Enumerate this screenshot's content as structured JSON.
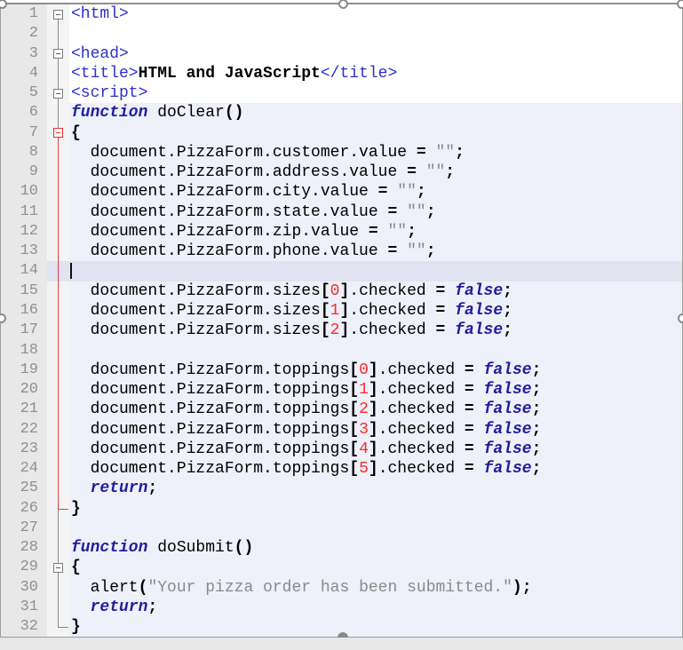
{
  "app": {
    "kind": "code-editor",
    "document_title_in_code": "HTML and JavaScript"
  },
  "colors": {
    "tag_blue": "#2F2FCE",
    "keyword_navy": "#1F1F9C",
    "number_red": "#FA2B2B",
    "string_gray": "#8A8A8A",
    "gutter_bg": "#E8E8E8",
    "js_region_bg": "#EEF0FA",
    "current_line_bg": "#E2E3F0",
    "active_fold_red": "#F23B3B"
  },
  "editor": {
    "current_line": 14,
    "lines": [
      {
        "n": 1,
        "fold": "box-first",
        "region": "html",
        "tokens": [
          [
            "tag",
            "<html>"
          ]
        ]
      },
      {
        "n": 2,
        "fold": "v",
        "region": "html",
        "tokens": []
      },
      {
        "n": 3,
        "fold": "box",
        "region": "html",
        "tokens": [
          [
            "tag",
            "<head>"
          ]
        ]
      },
      {
        "n": 4,
        "fold": "v",
        "region": "html",
        "tokens": [
          [
            "tag",
            "<title>"
          ],
          [
            "b",
            "HTML and JavaScript"
          ],
          [
            "tag",
            "</title>"
          ]
        ]
      },
      {
        "n": 5,
        "fold": "box",
        "region": "html",
        "tokens": [
          [
            "tag",
            "<script>"
          ]
        ]
      },
      {
        "n": 6,
        "fold": "v",
        "region": "js",
        "tokens": [
          [
            "kw",
            "function"
          ],
          [
            "pl",
            " doClear"
          ],
          [
            "op",
            "()"
          ]
        ]
      },
      {
        "n": 7,
        "fold": "box-red",
        "region": "js",
        "tokens": [
          [
            "op",
            "{"
          ]
        ]
      },
      {
        "n": 8,
        "fold": "v-red",
        "region": "js",
        "tokens": [
          [
            "pl",
            "  document.PizzaForm.customer.value "
          ],
          [
            "op",
            "="
          ],
          [
            "pl",
            " "
          ],
          [
            "str",
            "\"\""
          ],
          [
            "op",
            ";"
          ]
        ]
      },
      {
        "n": 9,
        "fold": "v-red",
        "region": "js",
        "tokens": [
          [
            "pl",
            "  document.PizzaForm.address.value "
          ],
          [
            "op",
            "="
          ],
          [
            "pl",
            " "
          ],
          [
            "str",
            "\"\""
          ],
          [
            "op",
            ";"
          ]
        ]
      },
      {
        "n": 10,
        "fold": "v-red",
        "region": "js",
        "tokens": [
          [
            "pl",
            "  document.PizzaForm.city.value "
          ],
          [
            "op",
            "="
          ],
          [
            "pl",
            " "
          ],
          [
            "str",
            "\"\""
          ],
          [
            "op",
            ";"
          ]
        ]
      },
      {
        "n": 11,
        "fold": "v-red",
        "region": "js",
        "tokens": [
          [
            "pl",
            "  document.PizzaForm.state.value "
          ],
          [
            "op",
            "="
          ],
          [
            "pl",
            " "
          ],
          [
            "str",
            "\"\""
          ],
          [
            "op",
            ";"
          ]
        ]
      },
      {
        "n": 12,
        "fold": "v-red",
        "region": "js",
        "tokens": [
          [
            "pl",
            "  document.PizzaForm.zip.value "
          ],
          [
            "op",
            "="
          ],
          [
            "pl",
            " "
          ],
          [
            "str",
            "\"\""
          ],
          [
            "op",
            ";"
          ]
        ]
      },
      {
        "n": 13,
        "fold": "v-red",
        "region": "js",
        "tokens": [
          [
            "pl",
            "  document.PizzaForm.phone.value "
          ],
          [
            "op",
            "="
          ],
          [
            "pl",
            " "
          ],
          [
            "str",
            "\"\""
          ],
          [
            "op",
            ";"
          ]
        ]
      },
      {
        "n": 14,
        "fold": "v-red",
        "region": "js",
        "current": true,
        "caret": true,
        "tokens": []
      },
      {
        "n": 15,
        "fold": "v-red",
        "region": "js",
        "tokens": [
          [
            "pl",
            "  document.PizzaForm.sizes"
          ],
          [
            "op",
            "["
          ],
          [
            "num",
            "0"
          ],
          [
            "op",
            "]"
          ],
          [
            "pl",
            ".checked "
          ],
          [
            "op",
            "="
          ],
          [
            "pl",
            " "
          ],
          [
            "kw",
            "false"
          ],
          [
            "op",
            ";"
          ]
        ]
      },
      {
        "n": 16,
        "fold": "v-red",
        "region": "js",
        "tokens": [
          [
            "pl",
            "  document.PizzaForm.sizes"
          ],
          [
            "op",
            "["
          ],
          [
            "num",
            "1"
          ],
          [
            "op",
            "]"
          ],
          [
            "pl",
            ".checked "
          ],
          [
            "op",
            "="
          ],
          [
            "pl",
            " "
          ],
          [
            "kw",
            "false"
          ],
          [
            "op",
            ";"
          ]
        ]
      },
      {
        "n": 17,
        "fold": "v-red",
        "region": "js",
        "tokens": [
          [
            "pl",
            "  document.PizzaForm.sizes"
          ],
          [
            "op",
            "["
          ],
          [
            "num",
            "2"
          ],
          [
            "op",
            "]"
          ],
          [
            "pl",
            ".checked "
          ],
          [
            "op",
            "="
          ],
          [
            "pl",
            " "
          ],
          [
            "kw",
            "false"
          ],
          [
            "op",
            ";"
          ]
        ]
      },
      {
        "n": 18,
        "fold": "v-red",
        "region": "js",
        "tokens": []
      },
      {
        "n": 19,
        "fold": "v-red",
        "region": "js",
        "tokens": [
          [
            "pl",
            "  document.PizzaForm.toppings"
          ],
          [
            "op",
            "["
          ],
          [
            "num",
            "0"
          ],
          [
            "op",
            "]"
          ],
          [
            "pl",
            ".checked "
          ],
          [
            "op",
            "="
          ],
          [
            "pl",
            " "
          ],
          [
            "kw",
            "false"
          ],
          [
            "op",
            ";"
          ]
        ]
      },
      {
        "n": 20,
        "fold": "v-red",
        "region": "js",
        "tokens": [
          [
            "pl",
            "  document.PizzaForm.toppings"
          ],
          [
            "op",
            "["
          ],
          [
            "num",
            "1"
          ],
          [
            "op",
            "]"
          ],
          [
            "pl",
            ".checked "
          ],
          [
            "op",
            "="
          ],
          [
            "pl",
            " "
          ],
          [
            "kw",
            "false"
          ],
          [
            "op",
            ";"
          ]
        ]
      },
      {
        "n": 21,
        "fold": "v-red",
        "region": "js",
        "tokens": [
          [
            "pl",
            "  document.PizzaForm.toppings"
          ],
          [
            "op",
            "["
          ],
          [
            "num",
            "2"
          ],
          [
            "op",
            "]"
          ],
          [
            "pl",
            ".checked "
          ],
          [
            "op",
            "="
          ],
          [
            "pl",
            " "
          ],
          [
            "kw",
            "false"
          ],
          [
            "op",
            ";"
          ]
        ]
      },
      {
        "n": 22,
        "fold": "v-red",
        "region": "js",
        "tokens": [
          [
            "pl",
            "  document.PizzaForm.toppings"
          ],
          [
            "op",
            "["
          ],
          [
            "num",
            "3"
          ],
          [
            "op",
            "]"
          ],
          [
            "pl",
            ".checked "
          ],
          [
            "op",
            "="
          ],
          [
            "pl",
            " "
          ],
          [
            "kw",
            "false"
          ],
          [
            "op",
            ";"
          ]
        ]
      },
      {
        "n": 23,
        "fold": "v-red",
        "region": "js",
        "tokens": [
          [
            "pl",
            "  document.PizzaForm.toppings"
          ],
          [
            "op",
            "["
          ],
          [
            "num",
            "4"
          ],
          [
            "op",
            "]"
          ],
          [
            "pl",
            ".checked "
          ],
          [
            "op",
            "="
          ],
          [
            "pl",
            " "
          ],
          [
            "kw",
            "false"
          ],
          [
            "op",
            ";"
          ]
        ]
      },
      {
        "n": 24,
        "fold": "v-red",
        "region": "js",
        "tokens": [
          [
            "pl",
            "  document.PizzaForm.toppings"
          ],
          [
            "op",
            "["
          ],
          [
            "num",
            "5"
          ],
          [
            "op",
            "]"
          ],
          [
            "pl",
            ".checked "
          ],
          [
            "op",
            "="
          ],
          [
            "pl",
            " "
          ],
          [
            "kw",
            "false"
          ],
          [
            "op",
            ";"
          ]
        ]
      },
      {
        "n": 25,
        "fold": "v-red",
        "region": "js",
        "tokens": [
          [
            "pl",
            "  "
          ],
          [
            "kw",
            "return"
          ],
          [
            "op",
            ";"
          ]
        ]
      },
      {
        "n": 26,
        "fold": "end-red",
        "region": "js",
        "tokens": [
          [
            "op",
            "}"
          ]
        ]
      },
      {
        "n": 27,
        "fold": "v",
        "region": "js",
        "tokens": []
      },
      {
        "n": 28,
        "fold": "v",
        "region": "js",
        "tokens": [
          [
            "kw",
            "function"
          ],
          [
            "pl",
            " doSubmit"
          ],
          [
            "op",
            "()"
          ]
        ]
      },
      {
        "n": 29,
        "fold": "box",
        "region": "js",
        "tokens": [
          [
            "op",
            "{"
          ]
        ]
      },
      {
        "n": 30,
        "fold": "v",
        "region": "js",
        "tokens": [
          [
            "pl",
            "  alert"
          ],
          [
            "op",
            "("
          ],
          [
            "str",
            "\"Your pizza order has been submitted.\""
          ],
          [
            "op",
            ")"
          ],
          [
            "op",
            ";"
          ]
        ]
      },
      {
        "n": 31,
        "fold": "v",
        "region": "js",
        "tokens": [
          [
            "pl",
            "  "
          ],
          [
            "kw",
            "return"
          ],
          [
            "op",
            ";"
          ]
        ]
      },
      {
        "n": 32,
        "fold": "end",
        "region": "js",
        "tokens": [
          [
            "op",
            "}"
          ]
        ]
      }
    ]
  },
  "overlay": {
    "handles": [
      "top-left",
      "top-middle",
      "top-right",
      "middle-left",
      "middle-right",
      "bottom-middle"
    ]
  }
}
